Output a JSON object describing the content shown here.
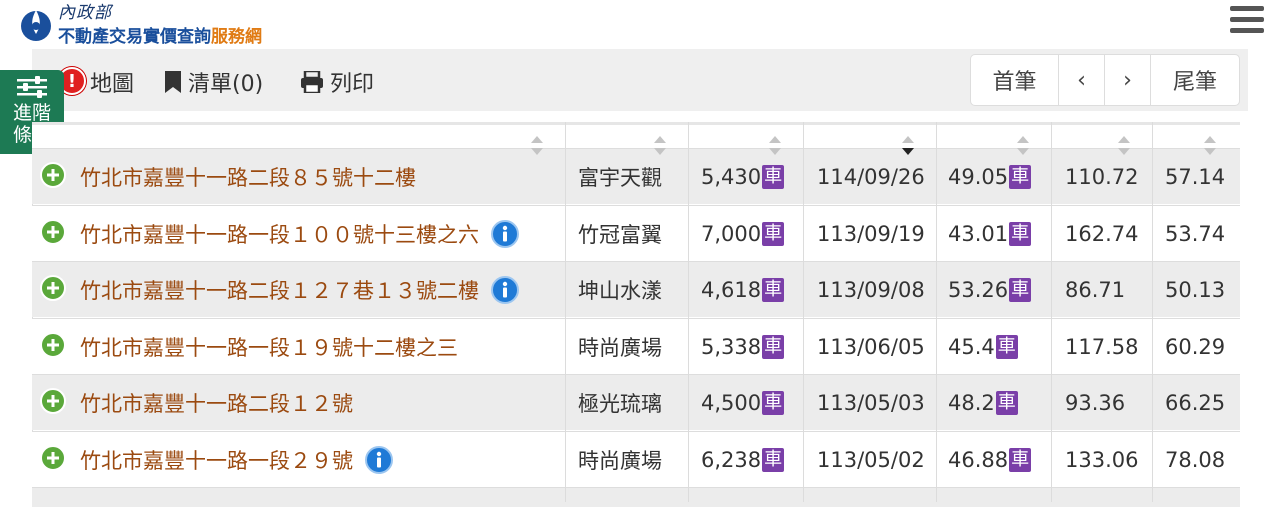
{
  "header": {
    "ministry": "內政部",
    "title_main": "不動產交易實價查詢",
    "title_accent": "服務網"
  },
  "toolbar": {
    "alert_mark": "!",
    "map_label": "地圖",
    "list_label": "清單(0)",
    "print_label": "列印"
  },
  "pager": {
    "first": "首筆",
    "prev": "‹",
    "next": "›",
    "last": "尾筆"
  },
  "side_tab": {
    "line1": "進階",
    "line2": "條件"
  },
  "car_label": "車",
  "rows": [
    {
      "address": "竹北市嘉豐十一路二段８５號十二樓",
      "info": false,
      "community": "富宇天觀",
      "price": "5,430",
      "price_car": true,
      "date": "114/09/26",
      "area": "49.05",
      "area_car": true,
      "unit_price": "110.72",
      "ratio": "57.14"
    },
    {
      "address": "竹北市嘉豐十一路一段１００號十三樓之六",
      "info": true,
      "community": "竹冠富翼",
      "price": "7,000",
      "price_car": true,
      "date": "113/09/19",
      "area": "43.01",
      "area_car": true,
      "unit_price": "162.74",
      "ratio": "53.74"
    },
    {
      "address": "竹北市嘉豐十一路二段１２７巷１３號二樓",
      "info": true,
      "community": "坤山水漾",
      "price": "4,618",
      "price_car": true,
      "date": "113/09/08",
      "area": "53.26",
      "area_car": true,
      "unit_price": "86.71",
      "ratio": "50.13"
    },
    {
      "address": "竹北市嘉豐十一路一段１９號十二樓之三",
      "info": false,
      "community": "時尚廣場",
      "price": "5,338",
      "price_car": true,
      "date": "113/06/05",
      "area": "45.4",
      "area_car": true,
      "unit_price": "117.58",
      "ratio": "60.29"
    },
    {
      "address": "竹北市嘉豐十一路二段１２號",
      "info": false,
      "community": "極光琉璃",
      "price": "4,500",
      "price_car": true,
      "date": "113/05/03",
      "area": "48.2",
      "area_car": true,
      "unit_price": "93.36",
      "ratio": "66.25"
    },
    {
      "address": "竹北市嘉豐十一路一段２９號",
      "info": true,
      "community": "時尚廣場",
      "price": "6,238",
      "price_car": true,
      "date": "113/05/02",
      "area": "46.88",
      "area_car": true,
      "unit_price": "133.06",
      "ratio": "78.08"
    }
  ]
}
